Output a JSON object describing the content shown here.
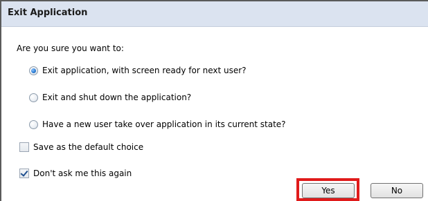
{
  "dialog": {
    "title": "Exit Application",
    "prompt": "Are you sure you want to:",
    "options": [
      {
        "label": "Exit application, with screen ready for next user?",
        "selected": true
      },
      {
        "label": "Exit and shut down the application?",
        "selected": false
      },
      {
        "label": "Have a new user take over application in its current state?",
        "selected": false
      }
    ],
    "checkboxes": [
      {
        "label": "Save as the default choice",
        "checked": false
      },
      {
        "label": "Don't ask me this again",
        "checked": true
      }
    ],
    "buttons": {
      "yes_label": "Yes",
      "no_label": "No"
    },
    "colors": {
      "titlebar_bg": "#dbe3f0",
      "highlight": "#e01b1b"
    }
  }
}
